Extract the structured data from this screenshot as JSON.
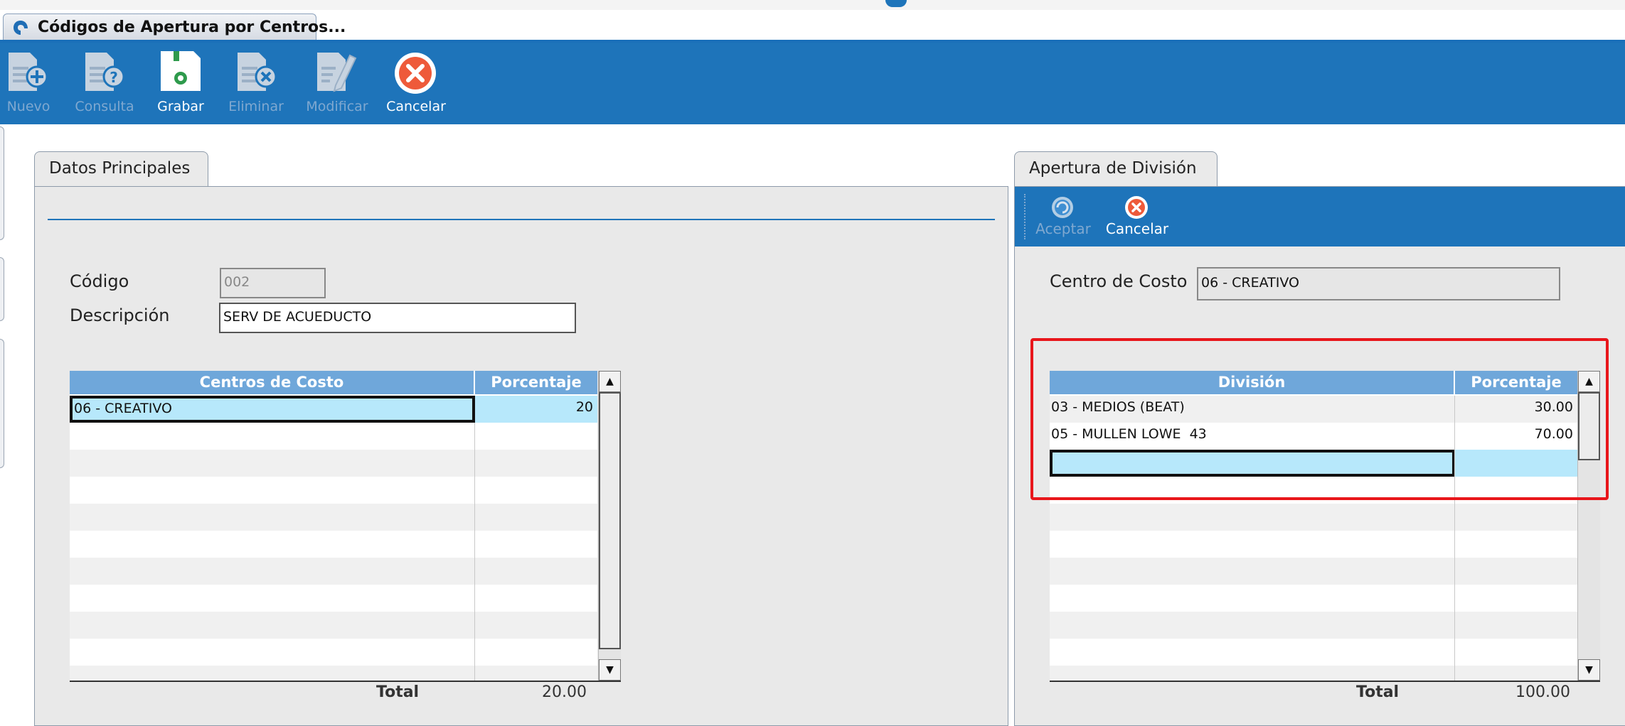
{
  "window": {
    "title": "Códigos de Apertura por Centros..."
  },
  "toolbar": {
    "buttons": [
      {
        "label": "Nuevo",
        "icon": "new-document-icon",
        "enabled": false
      },
      {
        "label": "Consulta",
        "icon": "query-document-icon",
        "enabled": false
      },
      {
        "label": "Grabar",
        "icon": "save-disk-icon",
        "enabled": true
      },
      {
        "label": "Eliminar",
        "icon": "delete-document-icon",
        "enabled": false
      },
      {
        "label": "Modificar",
        "icon": "edit-document-icon",
        "enabled": false
      },
      {
        "label": "Cancelar",
        "icon": "cancel-icon",
        "enabled": true
      }
    ]
  },
  "left_panel": {
    "tab_label": "Datos Principales",
    "codigo_label": "Código",
    "codigo_value": "002",
    "descripcion_label": "Descripción",
    "descripcion_value": "SERV DE ACUEDUCTO",
    "grid": {
      "headers": [
        "Centros de Costo",
        "Porcentaje"
      ],
      "rows": [
        {
          "centro": "06 - CREATIVO",
          "porcentaje": "20"
        }
      ],
      "total_label": "Total",
      "total_value": "20.00"
    }
  },
  "right_panel": {
    "tab_label": "Apertura de División",
    "sub_toolbar": {
      "aceptar_label": "Aceptar",
      "cancelar_label": "Cancelar"
    },
    "centro_label": "Centro de Costo",
    "centro_value": "06 - CREATIVO",
    "grid": {
      "headers": [
        "División",
        "Porcentaje"
      ],
      "rows": [
        {
          "division": "03 - MEDIOS (BEAT)",
          "porcentaje": "30.00"
        },
        {
          "division": "05 - MULLEN LOWE  43",
          "porcentaje": "70.00"
        },
        {
          "division": "",
          "porcentaje": ""
        }
      ],
      "total_label": "Total",
      "total_value": "100.00"
    }
  },
  "colors": {
    "toolbar_blue": "#1e74ba",
    "grid_header": "#6fa7da",
    "selected_row": "#b7e8fb",
    "highlight_red": "#e8161b"
  }
}
